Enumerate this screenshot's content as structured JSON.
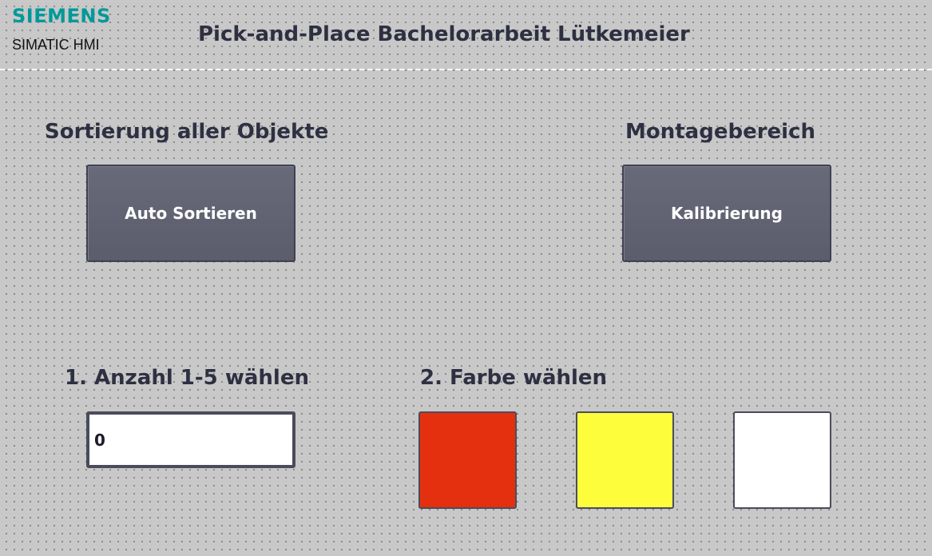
{
  "header": {
    "brand": "SIEMENS",
    "product": "SIMATIC HMI",
    "title": "Pick-and-Place Bachelorarbeit Lütkemeier",
    "brand_color": "#009999"
  },
  "sections": {
    "sort_all": {
      "label": "Sortierung aller Objekte",
      "button_label": "Auto Sortieren"
    },
    "assembly_area": {
      "label": "Montagebereich",
      "button_label": "Kalibrierung"
    },
    "quantity": {
      "label": "1. Anzahl 1-5 wählen",
      "value": "0"
    },
    "color": {
      "label": "2. Farbe wählen",
      "options": [
        {
          "name": "red",
          "color": "#e5300f"
        },
        {
          "name": "yellow",
          "color": "#fdfd3c"
        },
        {
          "name": "white",
          "color": "#ffffff"
        }
      ]
    }
  },
  "colors": {
    "background": "#c8c8c8",
    "button": "#5f6170",
    "text_dark": "#2e3042"
  }
}
